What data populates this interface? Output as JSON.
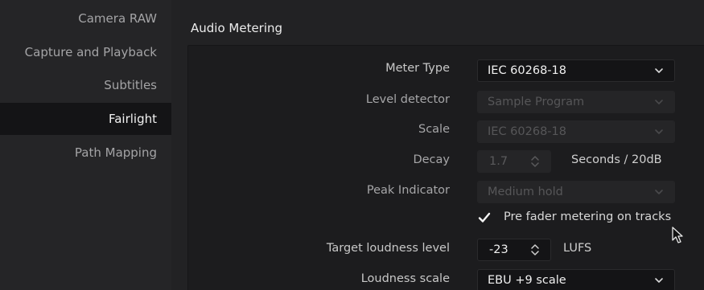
{
  "sidebar": {
    "items": [
      {
        "label": "Camera RAW"
      },
      {
        "label": "Capture and Playback"
      },
      {
        "label": "Subtitles"
      },
      {
        "label": "Fairlight"
      },
      {
        "label": "Path Mapping"
      }
    ],
    "active_index": 3
  },
  "main": {
    "section_title": "Audio Metering",
    "meter_type": {
      "label": "Meter Type",
      "value": "IEC 60268-18",
      "enabled": true
    },
    "level_detector": {
      "label": "Level detector",
      "value": "Sample Program",
      "enabled": false
    },
    "scale": {
      "label": "Scale",
      "value": "IEC 60268-18",
      "enabled": false
    },
    "decay": {
      "label": "Decay",
      "value": "1.7",
      "unit": "Seconds / 20dB",
      "enabled": false
    },
    "peak_indicator": {
      "label": "Peak Indicator",
      "value": "Medium hold",
      "enabled": false
    },
    "pre_fader": {
      "label": "Pre fader metering on tracks",
      "checked": true
    },
    "target_loudness": {
      "label": "Target loudness level",
      "value": "-23",
      "unit": "LUFS",
      "enabled": true
    },
    "loudness_scale": {
      "label": "Loudness scale",
      "value": "EBU +9 scale",
      "enabled": true
    }
  },
  "icons": {
    "dropdown": "chevron-down-icon",
    "stepper": "up-down-arrows-icon",
    "checkbox": "checkmark-icon",
    "cursor": "mouse-pointer-icon"
  },
  "colors": {
    "sidebar_bg": "#252527",
    "active_item_bg": "#141416",
    "panel_bg": "#1c1c1e",
    "control_bg": "#141416",
    "disabled_control_bg": "#252527"
  }
}
